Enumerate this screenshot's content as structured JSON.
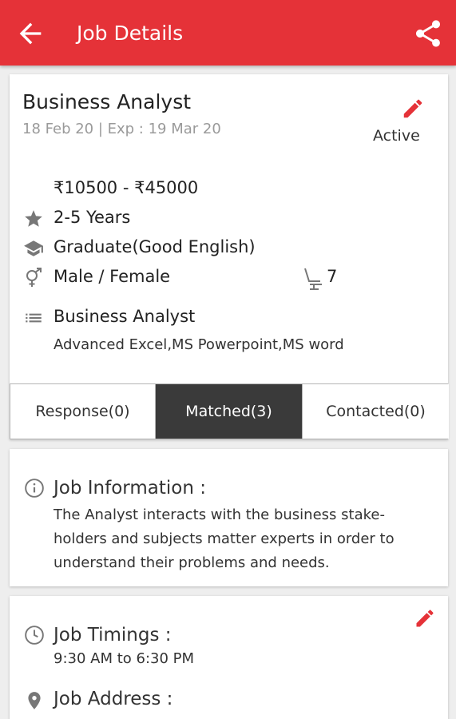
{
  "header": {
    "title": "Job Details",
    "color": "#e53238"
  },
  "job": {
    "title": "Business Analyst",
    "dates": "18 Feb 20 | Exp : 19 Mar 20",
    "status": "Active",
    "salary": "₹10500 - ₹45000",
    "experience": "2-5 Years",
    "education": "Graduate(Good English)",
    "gender": "Male / Female",
    "vacancies": "7",
    "category": "Business Analyst",
    "skills": "Advanced Excel,MS Powerpoint,MS word"
  },
  "tabs": [
    {
      "label": "Response(0)"
    },
    {
      "label": "Matched(3)",
      "active": true
    },
    {
      "label": "Contacted(0)"
    }
  ],
  "job_information": {
    "label": "Job Information :",
    "text": "The Analyst interacts with the business stake-holders and subjects matter experts in order to understand their problems and needs."
  },
  "job_timings": {
    "label": "Job Timings :",
    "value": "9:30 AM to 6:30 PM"
  },
  "job_address": {
    "label": "Job Address :"
  },
  "icons": {
    "back": "arrow-back-icon",
    "share": "share-icon",
    "edit": "pencil-icon",
    "experience": "star-icon",
    "education": "graduation-cap-icon",
    "gender": "gender-icon",
    "vacancies": "seat-icon",
    "category": "list-icon",
    "info": "info-icon",
    "timings": "clock-icon",
    "address": "location-pin-icon"
  }
}
